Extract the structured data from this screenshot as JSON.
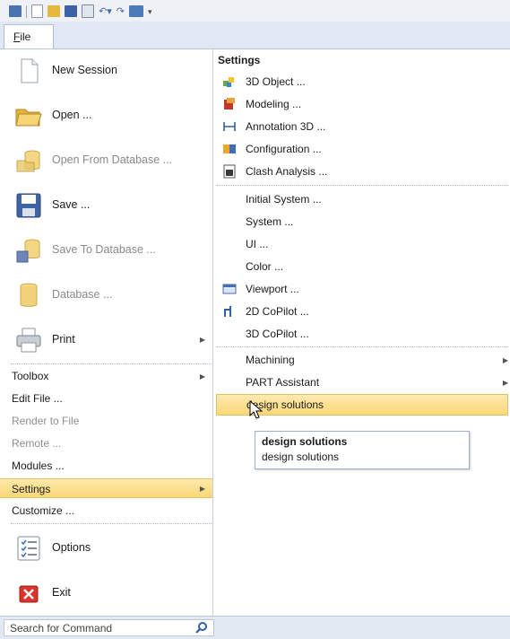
{
  "file_tab": "File",
  "left_menu": {
    "new_session": "New Session",
    "open": "Open ...",
    "open_from_db": "Open From Database ...",
    "save": "Save ...",
    "save_to_db": "Save To Database ...",
    "database": "Database ...",
    "print": "Print",
    "toolbox": "Toolbox",
    "edit_file": "Edit File ...",
    "render_to_file": "Render to File",
    "remote": "Remote ...",
    "modules": "Modules ...",
    "settings": "Settings",
    "customize": "Customize ...",
    "options": "Options",
    "exit": "Exit"
  },
  "settings_panel": {
    "title": "Settings",
    "items": [
      "3D Object ...",
      "Modeling ...",
      "Annotation 3D ...",
      "Configuration ...",
      "Clash Analysis ...",
      "Initial System ...",
      "System ...",
      "UI ...",
      "Color ...",
      "Viewport ...",
      "2D CoPilot ...",
      "3D CoPilot ...",
      "Machining",
      "PART Assistant",
      "design solutions"
    ]
  },
  "tooltip": {
    "title": "design solutions",
    "description": "design solutions"
  },
  "search": {
    "placeholder": "Search for Command"
  },
  "colors": {
    "highlight": "#fbd777",
    "tab_strip": "#dfe8f4",
    "accent_blue": "#3d62a6"
  }
}
